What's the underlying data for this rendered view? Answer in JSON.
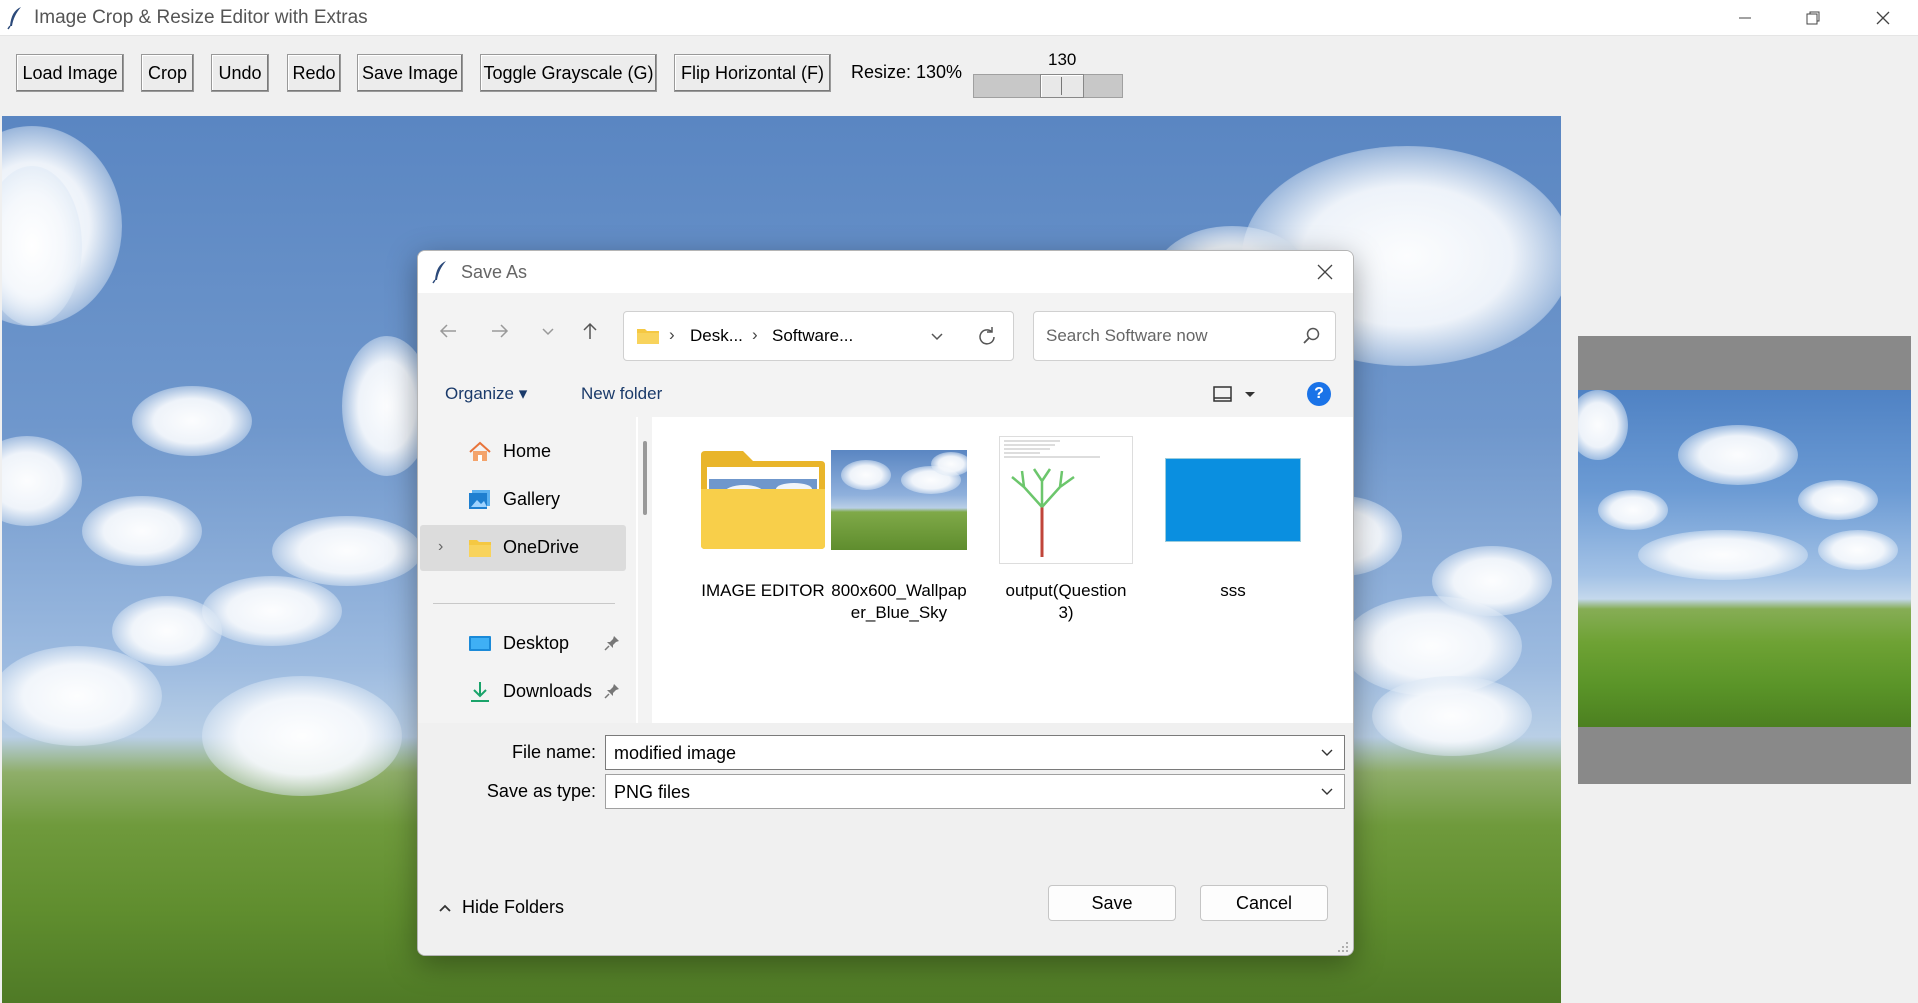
{
  "window": {
    "title": "Image Crop & Resize Editor with Extras"
  },
  "toolbar": {
    "load_label": "Load Image",
    "crop_label": "Crop",
    "undo_label": "Undo",
    "redo_label": "Redo",
    "save_label": "Save Image",
    "grayscale_label": "Toggle Grayscale (G)",
    "flip_label": "Flip Horizontal (F)",
    "resize_label": "Resize: 130%",
    "slider_value": "130"
  },
  "dialog": {
    "title": "Save As",
    "address": {
      "crumbs": [
        "Desk...",
        "Software..."
      ]
    },
    "search_placeholder": "Search Software now",
    "organize_label": "Organize",
    "new_folder_label": "New folder",
    "help_glyph": "?",
    "nav_items": [
      {
        "label": "Home",
        "icon": "home-icon"
      },
      {
        "label": "Gallery",
        "icon": "gallery-icon"
      },
      {
        "label": "OneDrive",
        "icon": "folder-icon",
        "selected": true
      },
      {
        "label": "Desktop",
        "icon": "desktop-icon",
        "pinned": true
      },
      {
        "label": "Downloads",
        "icon": "download-icon",
        "pinned": true
      }
    ],
    "files": [
      {
        "name": "IMAGE EDITOR",
        "type": "folder"
      },
      {
        "name": "800x600_Wallpaper_Blue_Sky",
        "name_line1": "800x600_Wallpap",
        "name_line2": "er_Blue_Sky",
        "type": "image"
      },
      {
        "name": "output(Question 3)",
        "name_line1": "output(Question",
        "name_line2": "3)",
        "type": "image"
      },
      {
        "name": "sss",
        "type": "image"
      }
    ],
    "file_name_label": "File name:",
    "file_name_value": "modified image",
    "save_type_label": "Save as type:",
    "save_type_value": "PNG files",
    "hide_folders_label": "Hide Folders",
    "save_button": "Save",
    "cancel_button": "Cancel"
  },
  "colors": {
    "accent": "#1a73e8",
    "folder_yellow": "#f5c842",
    "sss_blue": "#0a8fe0"
  }
}
